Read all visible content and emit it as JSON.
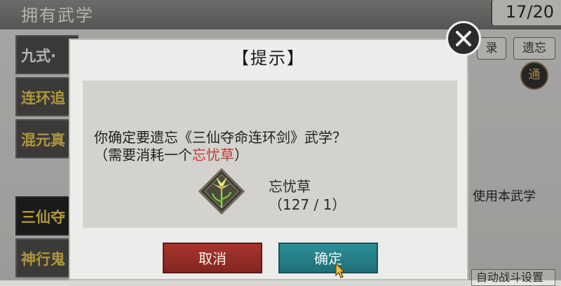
{
  "header": {
    "title": "拥有武学",
    "count": "17/20"
  },
  "list": {
    "items": [
      {
        "label": "九式·",
        "style": "white"
      },
      {
        "label": "连环追",
        "style": "gold"
      },
      {
        "label": "混元真",
        "style": "gold"
      },
      {
        "label": "三仙夺",
        "style": "gold"
      },
      {
        "label": "神行鬼",
        "style": "gold"
      }
    ]
  },
  "side": {
    "record_label": "录",
    "forget_label": "遗忘",
    "seal_label": "通",
    "use_text": "使用本武学",
    "auto_label": "自动战斗设置"
  },
  "dialog": {
    "title": "【提示】",
    "message_line1": "你确定要遗忘《三仙夺命连环剑》武学？",
    "message_line2_prefix": "（需要消耗一个",
    "message_line2_item": "忘忧草",
    "message_line2_suffix": "）",
    "item_name": "忘忧草",
    "item_count": "（127 / 1）",
    "cancel_label": "取消",
    "confirm_label": "确定"
  },
  "colors": {
    "cancel": "#a8342c",
    "confirm": "#2b8f98",
    "highlight": "#c23b2e",
    "gold_text": "#e9c84a"
  },
  "icons": [
    "close-icon",
    "lily-flower-icon",
    "cursor-icon"
  ]
}
